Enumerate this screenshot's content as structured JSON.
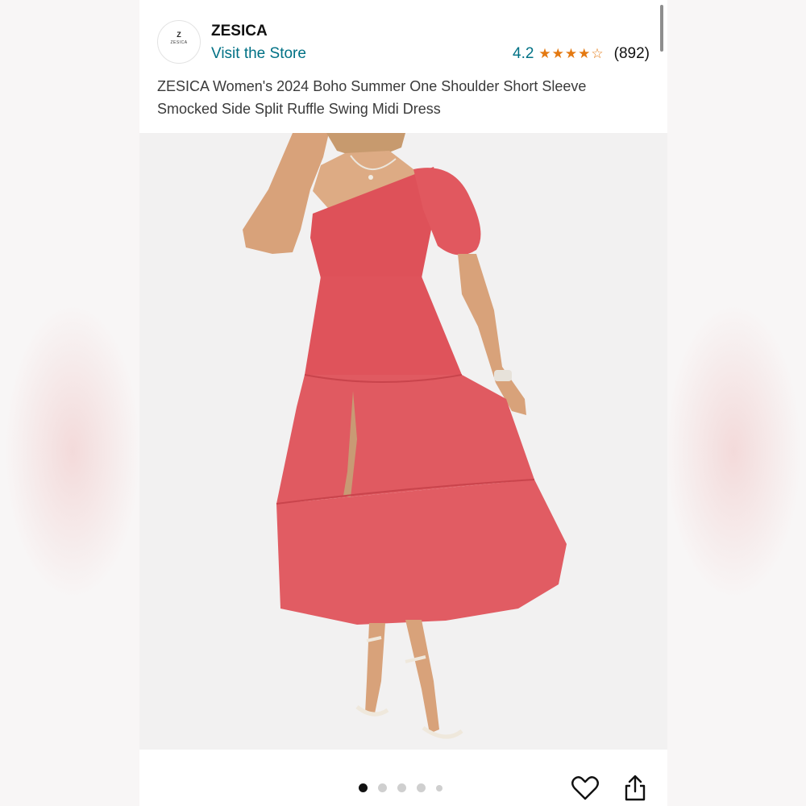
{
  "store": {
    "brand": "ZESICA",
    "logo_mark": "Z",
    "logo_text": "ZESICA",
    "visit_label": "Visit the Store"
  },
  "rating": {
    "value": "4.2",
    "stars": "★★★★",
    "half_star": "☆",
    "count": "(892)"
  },
  "product": {
    "title": "ZESICA Women's 2024 Boho Summer One Shoulder Short Sleeve Smocked Side Split Ruffle Swing Midi Dress",
    "image_alt": "model wearing coral one shoulder tiered midi dress"
  },
  "carousel": {
    "total_dots": 5,
    "active_index": 0
  },
  "actions": {
    "heart_icon": "heart-icon",
    "share_icon": "share-icon"
  },
  "colors": {
    "link": "#007185",
    "star": "#e47911",
    "dress": "#e0535a"
  }
}
